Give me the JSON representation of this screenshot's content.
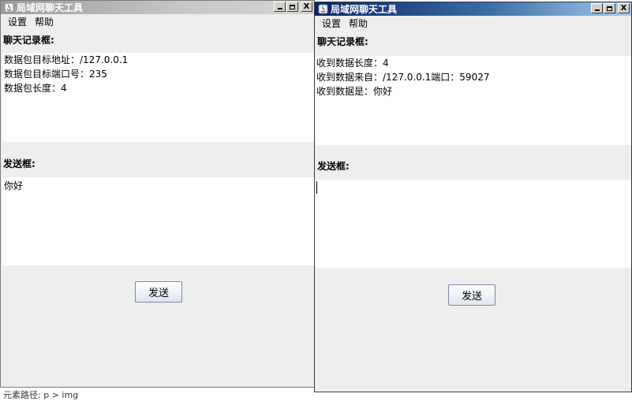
{
  "left_window": {
    "title": "局域网聊天工具",
    "menu": [
      "设置",
      "帮助"
    ],
    "chat_label": "聊天记录框:",
    "chat_lines": [
      "数据包目标地址：/127.0.0.1",
      "数据包目标端口号：235",
      "数据包长度：4"
    ],
    "send_label": "发送框:",
    "send_value": "你好",
    "send_button": "发送"
  },
  "right_window": {
    "title": "局域网聊天工具",
    "menu": [
      "设置",
      "帮助"
    ],
    "chat_label": "聊天记录框:",
    "chat_lines": [
      "收到数据长度：4",
      "收到数据来自：/127.0.0.1端口：59027",
      "收到数据是：你好"
    ],
    "send_label": "发送框:",
    "send_value": "",
    "send_button": "发送"
  },
  "window_controls": {
    "minimize": "_",
    "maximize": "□",
    "close": "X"
  },
  "background_text": "元素路径: p > img",
  "icons": [
    "java-app-icon",
    "minimize-icon",
    "maximize-icon",
    "close-icon"
  ]
}
